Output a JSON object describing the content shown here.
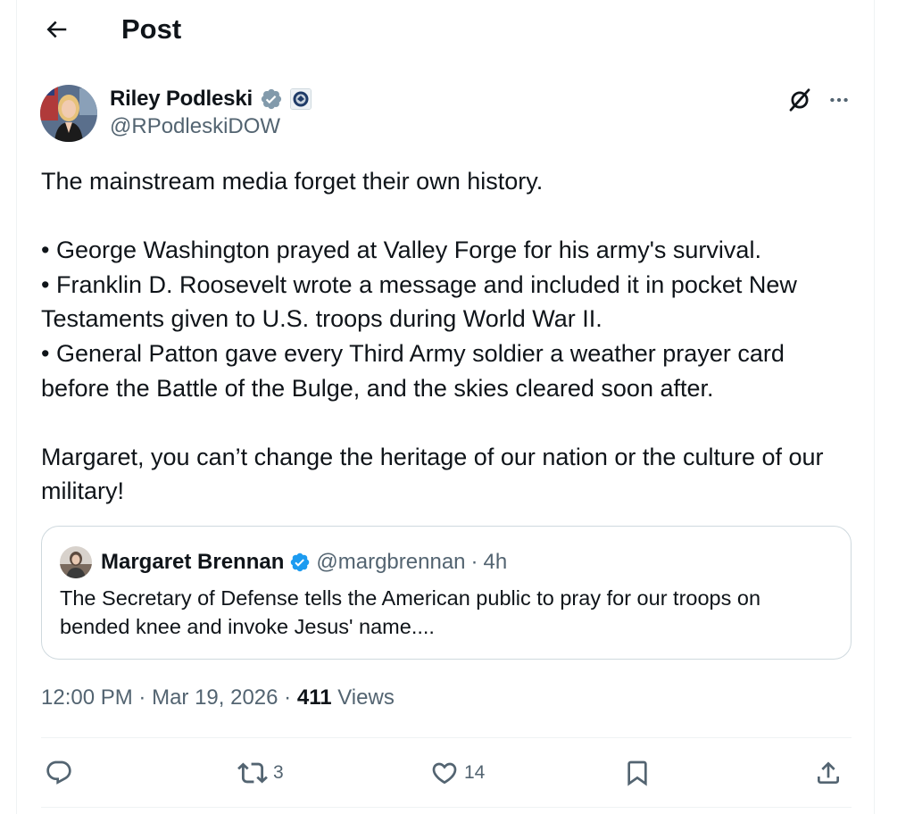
{
  "header": {
    "title": "Post"
  },
  "author": {
    "name": "Riley Podleski",
    "handle": "@RPodleskiDOW"
  },
  "post": {
    "paragraphs": [
      "The mainstream media forget their own history.",
      "• George Washington prayed at Valley Forge for his army's survival.\n• Franklin D. Roosevelt wrote a message and included it in pocket New Testaments given to U.S. troops during World War II.\n• General Patton gave every Third Army soldier a weather prayer card before the Battle of the Bulge, and the skies cleared soon after.",
      "Margaret, you can’t change the heritage of our nation or the culture of our military!"
    ]
  },
  "quote": {
    "name": "Margaret Brennan",
    "handle": "@margbrennan",
    "separator": "·",
    "age": "4h",
    "text": "The Secretary of Defense tells the American public to pray for our troops on bended knee and invoke Jesus' name...."
  },
  "meta": {
    "time": "12:00 PM",
    "dot": "·",
    "date": "Mar 19, 2026",
    "views_count": "411",
    "views_label": "Views"
  },
  "actions": {
    "reposts": "3",
    "likes": "14"
  },
  "colors": {
    "verified_blue": "#1d9bf0",
    "verified_gray": "#829aab",
    "text_primary": "#0f1419",
    "text_secondary": "#536471",
    "border": "#cfd9de"
  },
  "icons": {
    "back": "arrow-left-icon",
    "grok": "grok-icon",
    "more": "more-horizontal-icon",
    "reply": "reply-icon",
    "repost": "repost-icon",
    "like": "heart-icon",
    "bookmark": "bookmark-icon",
    "share": "share-icon"
  }
}
